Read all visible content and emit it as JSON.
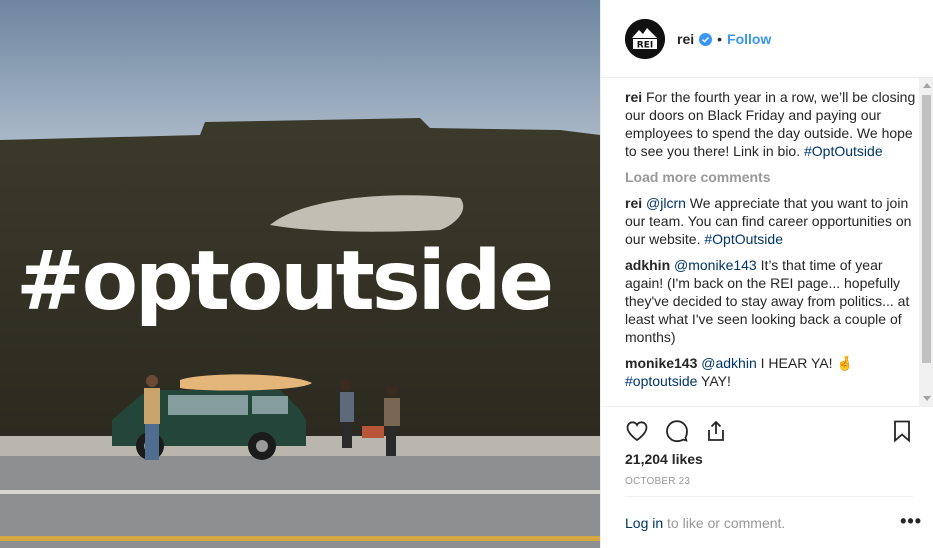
{
  "post": {
    "hashtag_overlay": "#optoutside"
  },
  "header": {
    "username": "rei",
    "separator": "•",
    "follow_label": "Follow",
    "avatar_logo_text": "REI"
  },
  "caption": {
    "author": "rei",
    "text": "For the fourth year in a row, we’ll be closing our doors on Black Friday and paying our employees to spend the day outside. We hope to see you there! Link in bio.",
    "hashtag": "#OptOutside"
  },
  "load_more_label": "Load more comments",
  "comments": [
    {
      "author": "rei",
      "mention": "@jlcrn",
      "text": "We appreciate that you want to join our team. You can find career opportunities on our website.",
      "hashtag": "#OptOutside"
    },
    {
      "author": "adkhin",
      "mention": "@monike143",
      "text": "It’s that time of year again! (I'm back on the REI page... hopefully they've decided to stay away from politics... at least what I've seen looking back a couple of months)"
    },
    {
      "author": "monike143",
      "mention": "@adkhin",
      "text": "I HEAR YA! 🤞",
      "hashtag": "#optoutside",
      "suffix": "YAY!"
    }
  ],
  "likes_text": "21,204 likes",
  "date_text": "OCTOBER 23",
  "login": {
    "link_label": "Log in",
    "rest_text": "to like or comment."
  },
  "more_label": "•••",
  "colors": {
    "accent_blue": "#3897f0",
    "link_navy": "#003569",
    "muted": "#999999",
    "text": "#262626"
  },
  "icons": [
    "heart-icon",
    "comment-icon",
    "share-icon",
    "bookmark-icon",
    "verified-badge-icon",
    "more-options-icon"
  ]
}
